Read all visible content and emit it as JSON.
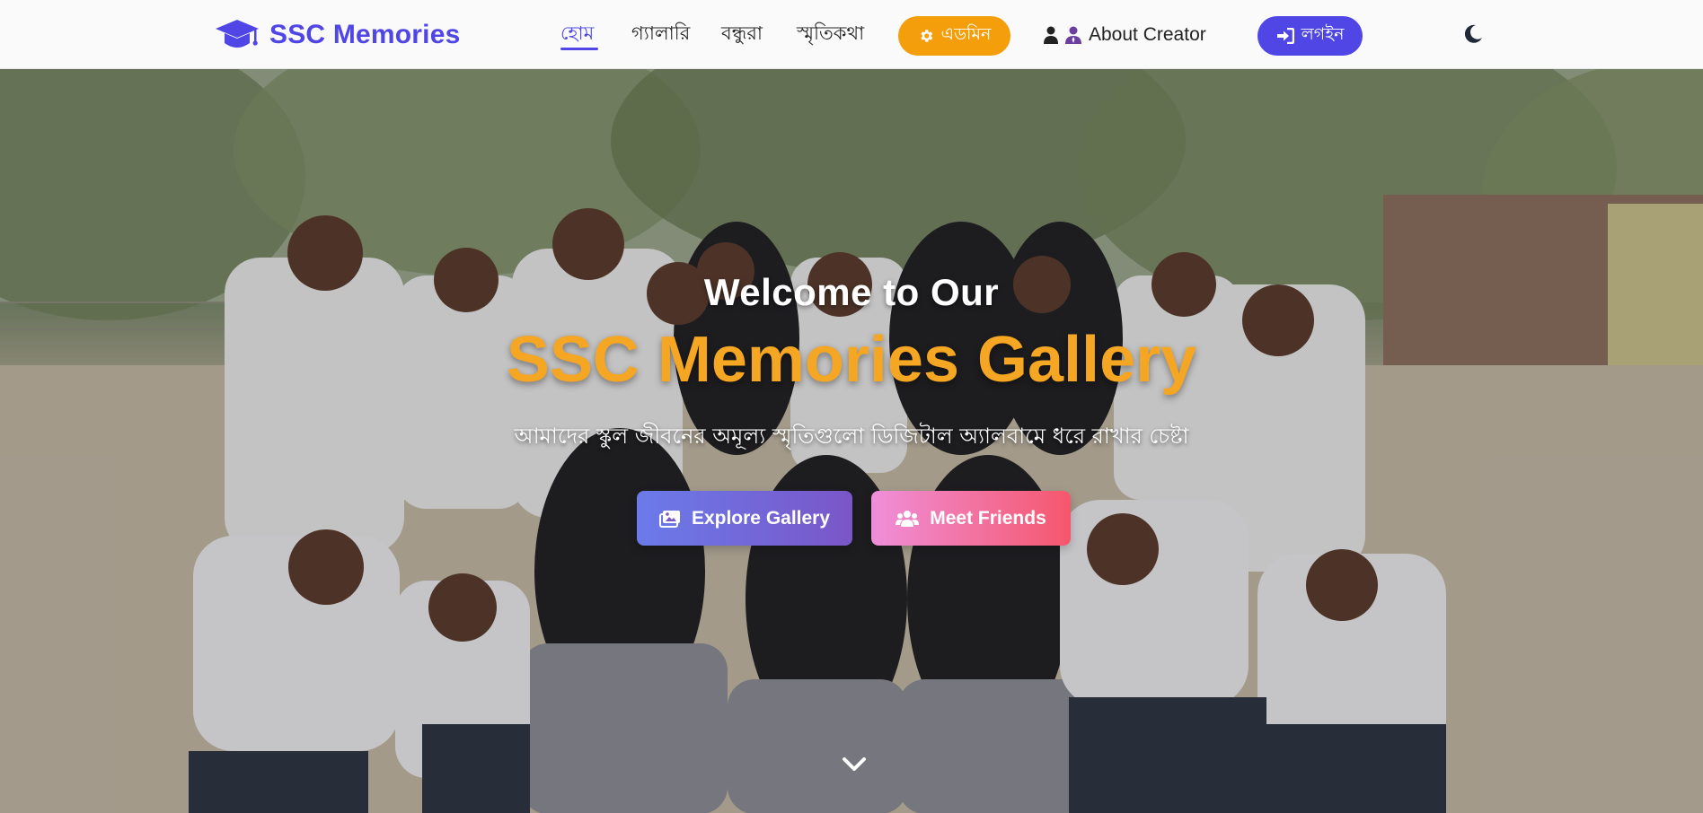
{
  "brand": {
    "name": "SSC Memories",
    "icon": "graduation-cap-icon",
    "color": "#4f46e5"
  },
  "nav": {
    "items": [
      {
        "label": "হোম",
        "active": true
      },
      {
        "label": "গ্যালারি",
        "active": false
      },
      {
        "label": "বন্ধুরা",
        "active": false
      },
      {
        "label": "স্মৃতিকথা",
        "active": false
      }
    ],
    "admin_label": "এডমিন",
    "admin_icon": "gear-icon",
    "about_label": "About Creator",
    "about_icons": [
      "user-icon",
      "user-tie-icon"
    ],
    "login_label": "লগইন",
    "login_icon": "sign-in-icon",
    "theme_icon": "moon-icon"
  },
  "hero": {
    "welcome": "Welcome to Our",
    "title": "SSC Memories Gallery",
    "subtitle": "আমাদের স্কুল জীবনের অমূল্য স্মৃতিগুলো ডিজিটাল অ্যালবামে ধরে রাখার চেষ্টা",
    "explore_label": "Explore Gallery",
    "explore_icon": "images-icon",
    "friends_label": "Meet Friends",
    "friends_icon": "users-icon",
    "scroll_icon": "chevron-down-icon"
  },
  "colors": {
    "primary": "#4f46e5",
    "admin": "#f59e0b",
    "title": "#f5a623",
    "explore_gradient": [
      "#6b7bea",
      "#7a56c8"
    ],
    "friends_gradient": [
      "#ef8fd9",
      "#f5576c"
    ]
  }
}
